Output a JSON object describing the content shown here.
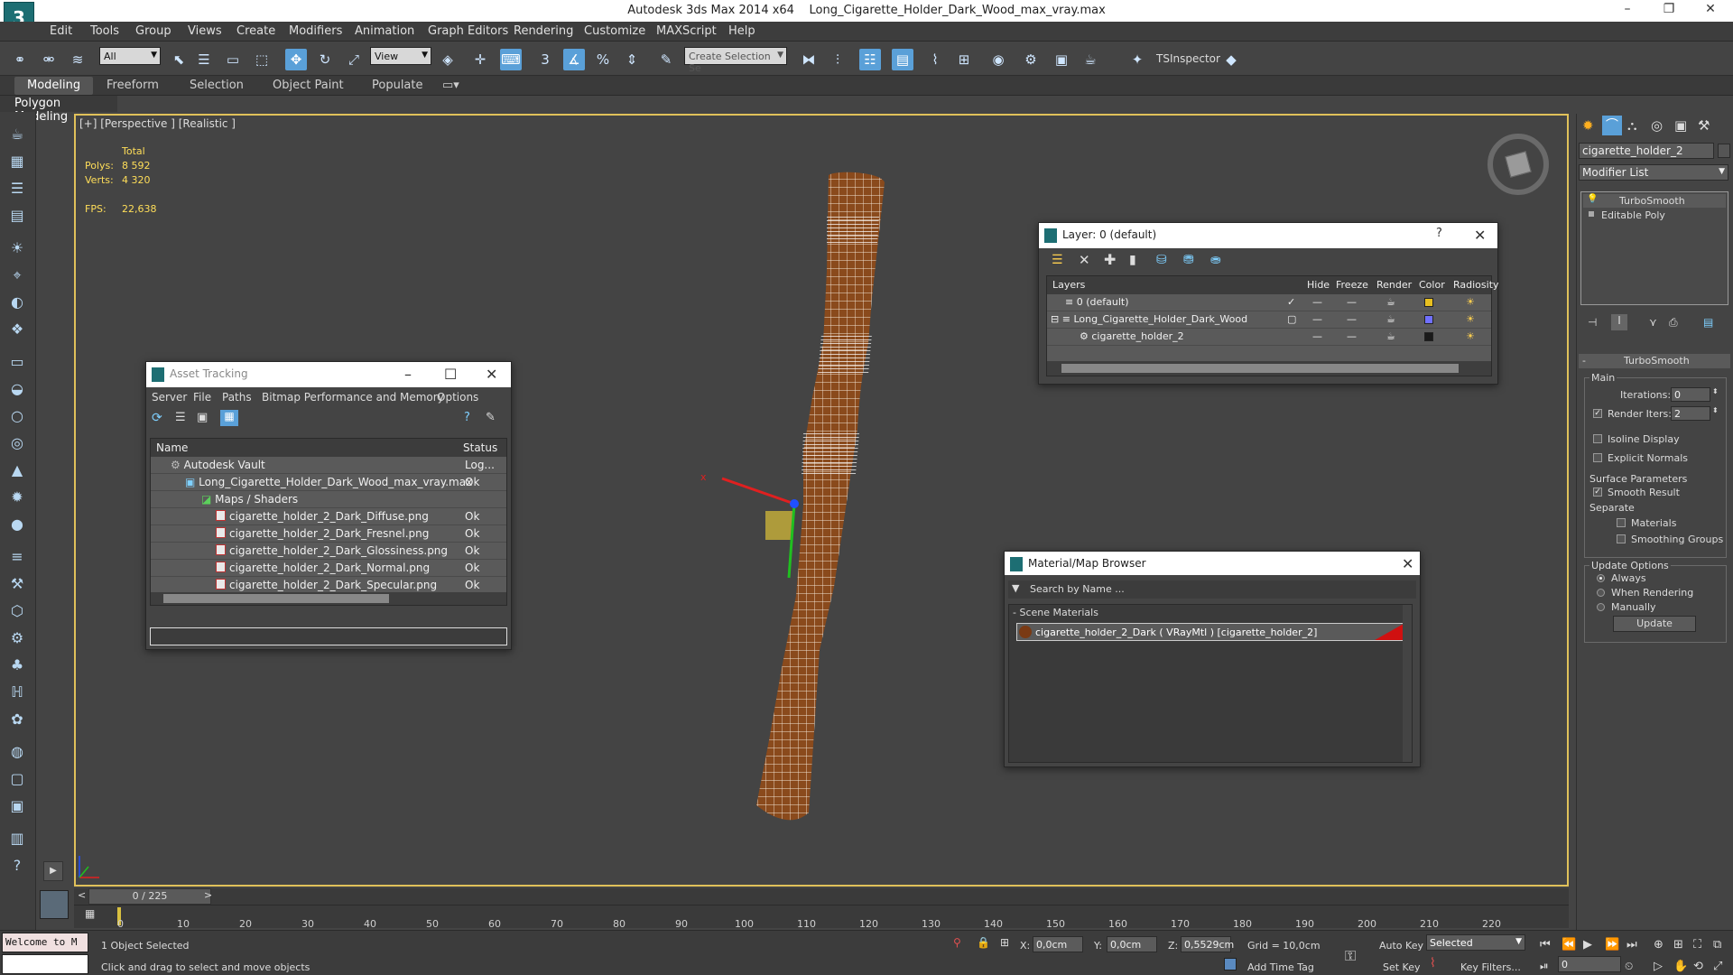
{
  "titlebar": {
    "app": "Autodesk 3ds Max  2014 x64",
    "file": "Long_Cigarette_Holder_Dark_Wood_max_vray.max",
    "logo": "3"
  },
  "menu": [
    "Edit",
    "Tools",
    "Group",
    "Views",
    "Create",
    "Modifiers",
    "Animation",
    "Graph Editors",
    "Rendering",
    "Customize",
    "MAXScript",
    "Help"
  ],
  "toolbar": {
    "filter_value": "All",
    "refcoord_value": "View",
    "snap_label": "3",
    "selection_set_placeholder": "Create Selection Se",
    "tsinspector": "TSInspector"
  },
  "ribbon": {
    "tabs": [
      "Modeling",
      "Freeform",
      "Selection",
      "Object Paint",
      "Populate"
    ],
    "sub": "Polygon Modeling"
  },
  "viewport": {
    "label": "[+] [Perspective ] [Realistic ]",
    "stats": {
      "total_label": "Total",
      "polys_label": "Polys:",
      "polys_value": "8 592",
      "verts_label": "Verts:",
      "verts_value": "4 320",
      "fps_label": "FPS:",
      "fps_value": "22,638"
    },
    "gizmo_x": "x",
    "colors": {
      "frame": "#e0c15a",
      "wood": "#8a4a1c",
      "wire": "#f3e6d6"
    }
  },
  "asset_tracking": {
    "title": "Asset Tracking",
    "menu": [
      "Server",
      "File",
      "Paths",
      "Bitmap Performance and Memory",
      "Options"
    ],
    "columns": [
      "Name",
      "Status"
    ],
    "rows": [
      {
        "name": "Autodesk Vault",
        "status": "Log..."
      },
      {
        "name": "Long_Cigarette_Holder_Dark_Wood_max_vray.max",
        "status": "Ok"
      },
      {
        "name": "Maps / Shaders",
        "status": ""
      },
      {
        "name": "cigarette_holder_2_Dark_Diffuse.png",
        "status": "Ok"
      },
      {
        "name": "cigarette_holder_2_Dark_Fresnel.png",
        "status": "Ok"
      },
      {
        "name": "cigarette_holder_2_Dark_Glossiness.png",
        "status": "Ok"
      },
      {
        "name": "cigarette_holder_2_Dark_Normal.png",
        "status": "Ok"
      },
      {
        "name": "cigarette_holder_2_Dark_Specular.png",
        "status": "Ok"
      }
    ]
  },
  "layer_window": {
    "title": "Layer: 0 (default)",
    "help": "?",
    "columns": [
      "Layers",
      "Hide",
      "Freeze",
      "Render",
      "Color",
      "Radiosity"
    ],
    "rows": [
      {
        "name": "0 (default)",
        "color": "#e8c020"
      },
      {
        "name": "Long_Cigarette_Holder_Dark_Wood",
        "color": "#7070ff"
      },
      {
        "name": "cigarette_holder_2",
        "color": "#1a1a1a"
      }
    ]
  },
  "material_browser": {
    "title": "Material/Map Browser",
    "search_placeholder": "Search by Name ...",
    "section": "Scene Materials",
    "item": "cigarette_holder_2_Dark  ( VRayMtl ) [cigarette_holder_2]"
  },
  "command_panel": {
    "object_name": "cigarette_holder_2",
    "modifier_list": "Modifier List",
    "stack": [
      "TurboSmooth",
      "Editable Poly"
    ],
    "rollout": "TurboSmooth",
    "main": "Main",
    "iterations_label": "Iterations:",
    "iterations_value": "0",
    "render_iters_label": "Render Iters:",
    "render_iters_value": "2",
    "isoline": "Isoline Display",
    "explicit": "Explicit Normals",
    "surface_params": "Surface Parameters",
    "smooth_result": "Smooth Result",
    "separate": "Separate",
    "materials": "Materials",
    "smoothing_groups": "Smoothing Groups",
    "update_options": "Update Options",
    "always": "Always",
    "when_rendering": "When Rendering",
    "manually": "Manually",
    "update_button": "Update"
  },
  "timeline": {
    "frame": "0 / 225",
    "ticks": [
      "0",
      "10",
      "20",
      "30",
      "40",
      "50",
      "60",
      "70",
      "80",
      "90",
      "100",
      "110",
      "120",
      "130",
      "140",
      "150",
      "160",
      "170",
      "180",
      "190",
      "200",
      "210",
      "220"
    ]
  },
  "status": {
    "welcome": "Welcome to M",
    "selected": "1 Object Selected",
    "hint": "Click and drag to select and move objects",
    "x_label": "X:",
    "x_value": "0,0cm",
    "y_label": "Y:",
    "y_value": "0,0cm",
    "z_label": "Z:",
    "z_value": "0,5529cm",
    "grid": "Grid = 10,0cm",
    "add_time_tag": "Add Time Tag",
    "auto_key": "Auto Key",
    "set_key": "Set Key",
    "selected_dropdown": "Selected",
    "key_filters": "Key Filters...",
    "frame_value": "0"
  }
}
